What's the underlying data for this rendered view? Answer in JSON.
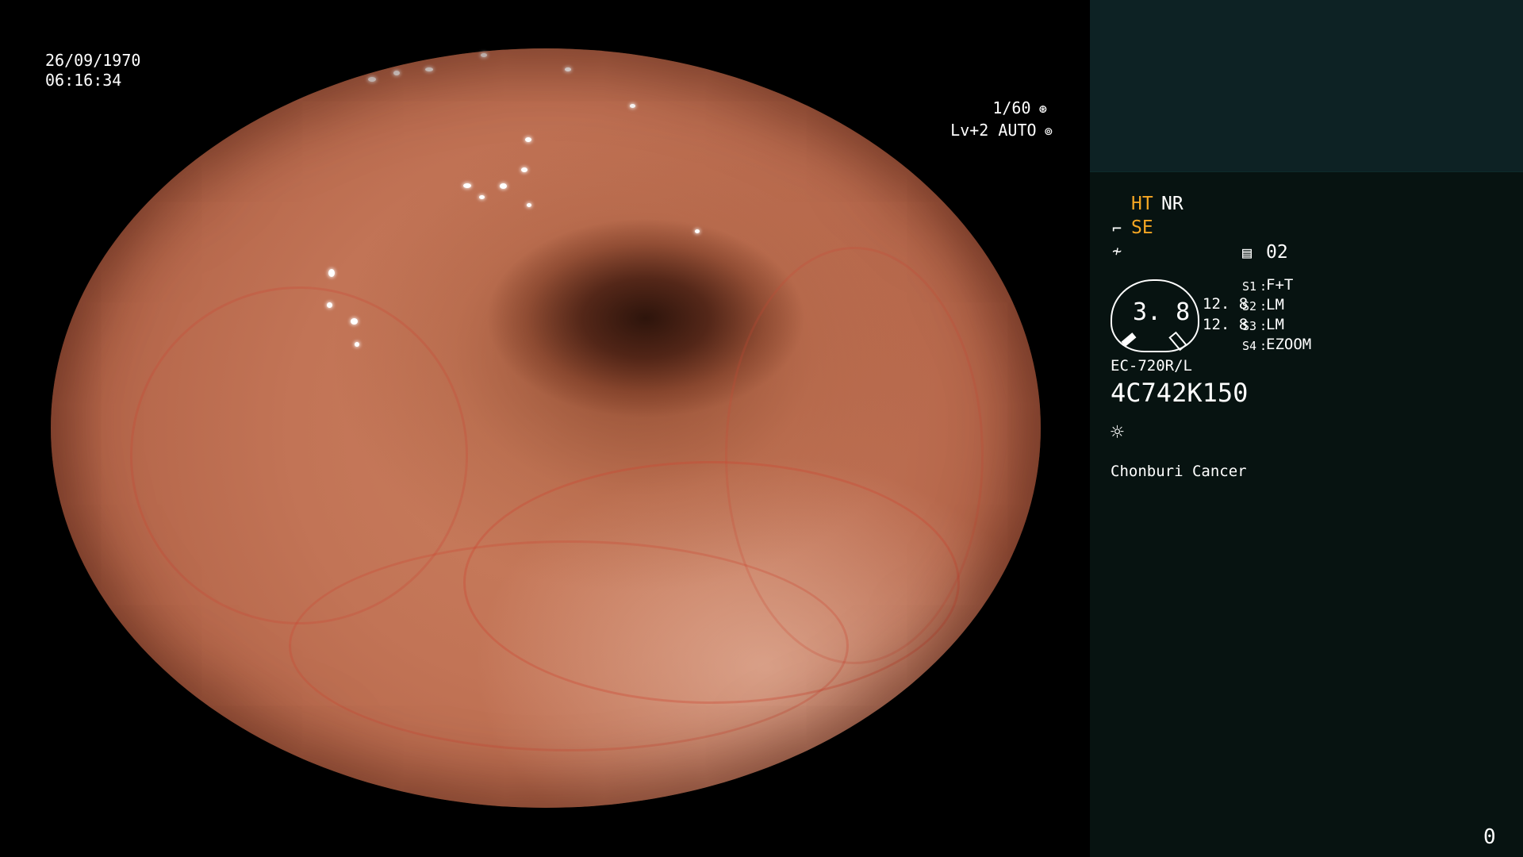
{
  "overlay": {
    "date": "26/09/1970",
    "time": "06:16:34",
    "shutter": "1/60",
    "level": "Lv+2 AUTO"
  },
  "panel": {
    "ht": "HT",
    "nr": "NR",
    "se": "SE",
    "program": "02",
    "zoom_value": "3. 8",
    "ratio_top": "12. 8",
    "ratio_bottom": "12. 8",
    "switches": [
      {
        "key": "S1",
        "value": "F+T"
      },
      {
        "key": "S2",
        "value": "LM"
      },
      {
        "key": "S3",
        "value": "LM"
      },
      {
        "key": "S4",
        "value": "EZOOM"
      }
    ],
    "scope_model": "EC-720R/L",
    "serial": "4C742K150",
    "institution": "Chonburi Cancer",
    "counter": "0"
  },
  "colors": {
    "amber": "#f5a623",
    "panel_bg": "#071311",
    "panel_top_bg": "#0d2224"
  },
  "icons": [
    "shutter-icon",
    "iris-icon",
    "freeze-icon",
    "edge-icon",
    "program-icon",
    "light-icon"
  ]
}
